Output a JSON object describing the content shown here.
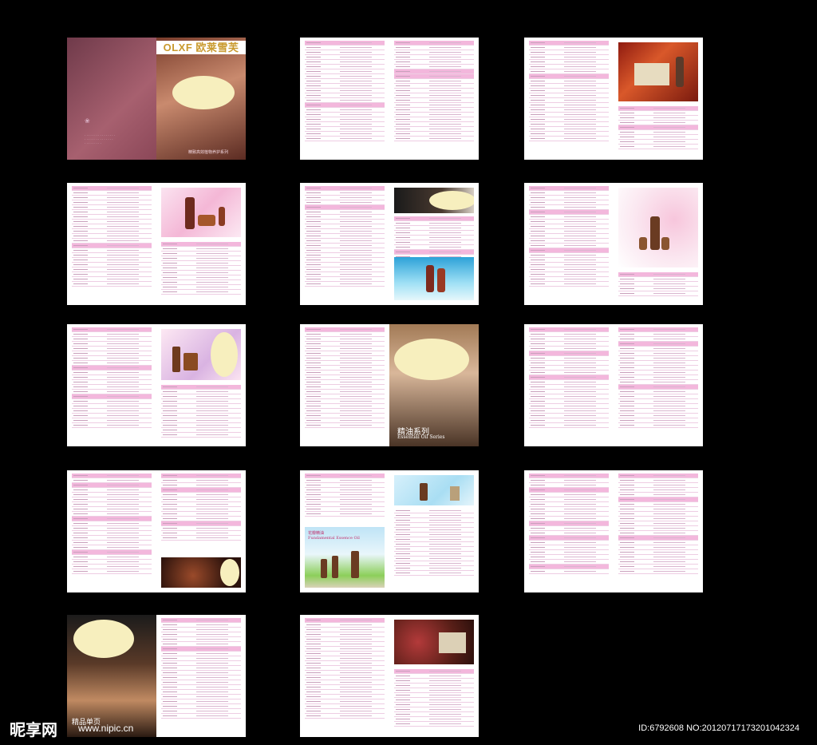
{
  "brand": {
    "logo_text": "OLXF 欧莱雪芙",
    "tagline": "精致高效植物养护系列"
  },
  "spreads": [
    {
      "id": "cover"
    },
    {
      "id": "price-list-1"
    },
    {
      "id": "price-list-2"
    },
    {
      "id": "price-list-3"
    },
    {
      "id": "price-list-4"
    },
    {
      "id": "price-list-5"
    },
    {
      "id": "price-list-6"
    },
    {
      "id": "essential-oil-opener"
    },
    {
      "id": "price-list-7"
    },
    {
      "id": "price-list-8"
    },
    {
      "id": "price-list-9"
    },
    {
      "id": "price-list-10"
    },
    {
      "id": "back-cover"
    },
    {
      "id": "price-list-11"
    }
  ],
  "essential_oil": {
    "title_cn": "精油系列",
    "title_en": "Essential Oil Series"
  },
  "flower_oil": {
    "title_cn": "花瓣精油",
    "title_en": "Fundamental Essence Oil"
  },
  "watermark": {
    "site": "昵享网",
    "url": "www.nipic.cn",
    "stamp": "精品单页",
    "id_text": "ID:6792608 NO:20120717173201042324"
  },
  "colors": {
    "background": "#000000",
    "accent_pink": "#f3a8d8",
    "brand_gold": "#c99a2e"
  }
}
